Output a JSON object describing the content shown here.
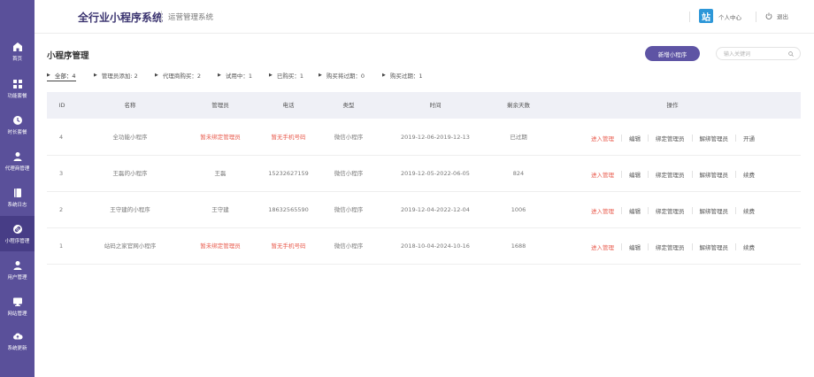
{
  "header": {
    "title": "全行业小程序系统",
    "subtitle": "运营管理系统",
    "logo_glyph": "站",
    "user_center": "个人中心",
    "logout": "退出"
  },
  "sidebar": {
    "items": [
      {
        "label": "首页",
        "icon": "home-icon"
      },
      {
        "label": "功能套餐",
        "icon": "grid-icon"
      },
      {
        "label": "时长套餐",
        "icon": "clock-icon"
      },
      {
        "label": "代理商管理",
        "icon": "person-icon"
      },
      {
        "label": "系统日志",
        "icon": "book-icon"
      },
      {
        "label": "小程序管理",
        "icon": "link-icon"
      },
      {
        "label": "用户管理",
        "icon": "users-icon"
      },
      {
        "label": "网站管理",
        "icon": "monitor-icon"
      },
      {
        "label": "系统更新",
        "icon": "cloud-upload-icon"
      }
    ],
    "active_index": 5
  },
  "main": {
    "page_title": "小程序管理",
    "add_button": "新增小程序",
    "search_placeholder": "输入关键词",
    "filters": [
      {
        "label": "全部：4",
        "active": true
      },
      {
        "label": "管理员添加: 2",
        "active": false
      },
      {
        "label": "代理商购买：2",
        "active": false
      },
      {
        "label": "试用中：1",
        "active": false
      },
      {
        "label": "已购买：1",
        "active": false
      },
      {
        "label": "购买将过期：0",
        "active": false
      },
      {
        "label": "购买过期：1",
        "active": false
      }
    ],
    "table": {
      "headers": [
        "ID",
        "名称",
        "管理员",
        "电话",
        "类型",
        "时间",
        "剩余天数",
        "操作"
      ],
      "rows": [
        {
          "id": "4",
          "name": "全功能小程序",
          "admin": "暂未绑定管理员",
          "phone": "暂无手机号码",
          "type": "微信小程序",
          "time": "2019-12-06-2019-12-13",
          "days": "已过期",
          "actions": [
            "进入管理",
            "编辑",
            "绑定管理员",
            "解绑管理员",
            "开通"
          ]
        },
        {
          "id": "3",
          "name": "王磊的小程序",
          "admin": "王磊",
          "phone": "15232627159",
          "type": "微信小程序",
          "time": "2019-12-05-2022-06-05",
          "days": "824",
          "actions": [
            "进入管理",
            "编辑",
            "绑定管理员",
            "解绑管理员",
            "续费"
          ]
        },
        {
          "id": "2",
          "name": "王守建的小程序",
          "admin": "王守建",
          "phone": "18632565590",
          "type": "微信小程序",
          "time": "2019-12-04-2022-12-04",
          "days": "1006",
          "actions": [
            "进入管理",
            "编辑",
            "绑定管理员",
            "解绑管理员",
            "续费"
          ]
        },
        {
          "id": "1",
          "name": "站码之家官网小程序",
          "admin": "暂未绑定管理员",
          "phone": "暂无手机号码",
          "type": "微信小程序",
          "time": "2018-10-04-2024-10-16",
          "days": "1688",
          "actions": [
            "进入管理",
            "编辑",
            "绑定管理员",
            "解绑管理员",
            "续费"
          ]
        }
      ]
    }
  },
  "colors": {
    "sidebar": "#5a509a",
    "sidebar_active": "#473d86",
    "title": "#3b3470",
    "primary_button": "#5e54a4",
    "alert_text": "#e85b4d",
    "table_header_bg": "#eff0f6"
  }
}
